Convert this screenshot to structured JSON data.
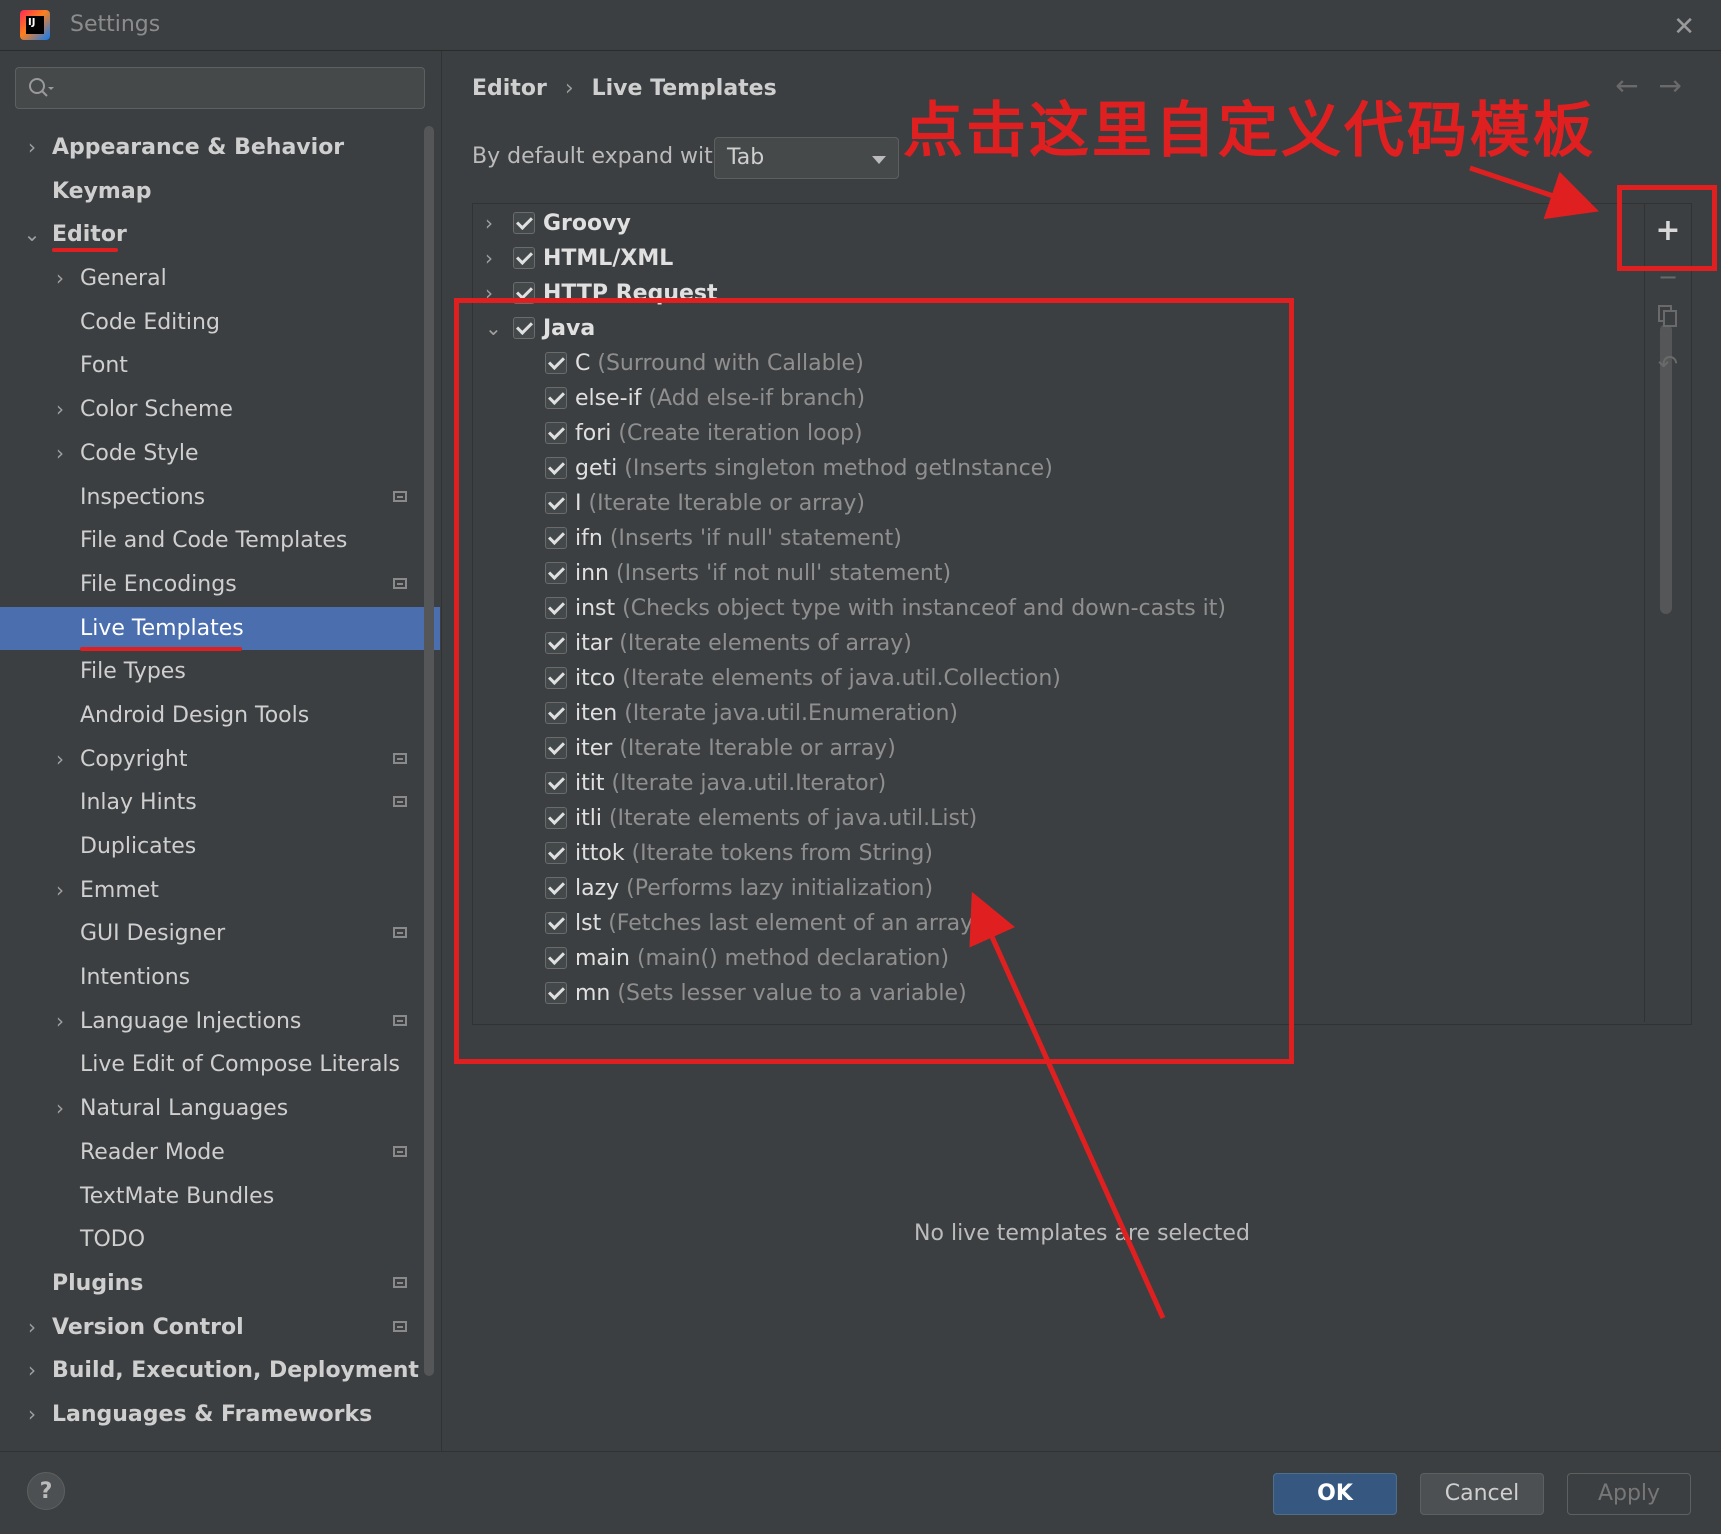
{
  "window": {
    "title": "Settings"
  },
  "sidebar": {
    "items": [
      {
        "label": "Appearance & Behavior",
        "level": 0,
        "arrow": "right",
        "bold": true
      },
      {
        "label": "Keymap",
        "level": 0,
        "arrow": "",
        "bold": true
      },
      {
        "label": "Editor",
        "level": 0,
        "arrow": "down",
        "bold": true
      },
      {
        "label": "General",
        "level": 1,
        "arrow": "right"
      },
      {
        "label": "Code Editing",
        "level": 1,
        "arrow": ""
      },
      {
        "label": "Font",
        "level": 1,
        "arrow": ""
      },
      {
        "label": "Color Scheme",
        "level": 1,
        "arrow": "right"
      },
      {
        "label": "Code Style",
        "level": 1,
        "arrow": "right"
      },
      {
        "label": "Inspections",
        "level": 1,
        "arrow": "",
        "project": true
      },
      {
        "label": "File and Code Templates",
        "level": 1,
        "arrow": ""
      },
      {
        "label": "File Encodings",
        "level": 1,
        "arrow": "",
        "project": true
      },
      {
        "label": "Live Templates",
        "level": 1,
        "arrow": "",
        "selected": true
      },
      {
        "label": "File Types",
        "level": 1,
        "arrow": ""
      },
      {
        "label": "Android Design Tools",
        "level": 1,
        "arrow": ""
      },
      {
        "label": "Copyright",
        "level": 1,
        "arrow": "right",
        "project": true
      },
      {
        "label": "Inlay Hints",
        "level": 1,
        "arrow": "",
        "project": true
      },
      {
        "label": "Duplicates",
        "level": 1,
        "arrow": ""
      },
      {
        "label": "Emmet",
        "level": 1,
        "arrow": "right"
      },
      {
        "label": "GUI Designer",
        "level": 1,
        "arrow": "",
        "project": true
      },
      {
        "label": "Intentions",
        "level": 1,
        "arrow": ""
      },
      {
        "label": "Language Injections",
        "level": 1,
        "arrow": "right",
        "project": true
      },
      {
        "label": "Live Edit of Compose Literals",
        "level": 1,
        "arrow": ""
      },
      {
        "label": "Natural Languages",
        "level": 1,
        "arrow": "right"
      },
      {
        "label": "Reader Mode",
        "level": 1,
        "arrow": "",
        "project": true
      },
      {
        "label": "TextMate Bundles",
        "level": 1,
        "arrow": ""
      },
      {
        "label": "TODO",
        "level": 1,
        "arrow": ""
      },
      {
        "label": "Plugins",
        "level": 0,
        "arrow": "",
        "bold": true,
        "project": true
      },
      {
        "label": "Version Control",
        "level": 0,
        "arrow": "right",
        "bold": true,
        "project": true
      },
      {
        "label": "Build, Execution, Deployment",
        "level": 0,
        "arrow": "right",
        "bold": true
      },
      {
        "label": "Languages & Frameworks",
        "level": 0,
        "arrow": "right",
        "bold": true
      }
    ]
  },
  "breadcrumb": {
    "parent": "Editor",
    "separator": "›",
    "current": "Live Templates"
  },
  "expand": {
    "label": "By default expand with",
    "value": "Tab"
  },
  "groups": [
    {
      "name": "Groovy",
      "expanded": false,
      "checked": true
    },
    {
      "name": "HTML/XML",
      "expanded": false,
      "checked": true
    },
    {
      "name": "HTTP Request",
      "expanded": false,
      "checked": true
    },
    {
      "name": "Java",
      "expanded": true,
      "checked": true
    }
  ],
  "java_templates": [
    {
      "abbr": "C",
      "desc": "(Surround with Callable)"
    },
    {
      "abbr": "else-if",
      "desc": "(Add else-if branch)"
    },
    {
      "abbr": "fori",
      "desc": "(Create iteration loop)"
    },
    {
      "abbr": "geti",
      "desc": "(Inserts singleton method getInstance)"
    },
    {
      "abbr": "I",
      "desc": "(Iterate Iterable or array)"
    },
    {
      "abbr": "ifn",
      "desc": "(Inserts 'if null' statement)"
    },
    {
      "abbr": "inn",
      "desc": "(Inserts 'if not null' statement)"
    },
    {
      "abbr": "inst",
      "desc": "(Checks object type with instanceof and down-casts it)"
    },
    {
      "abbr": "itar",
      "desc": "(Iterate elements of array)"
    },
    {
      "abbr": "itco",
      "desc": "(Iterate elements of java.util.Collection)"
    },
    {
      "abbr": "iten",
      "desc": "(Iterate java.util.Enumeration)"
    },
    {
      "abbr": "iter",
      "desc": "(Iterate Iterable or array)"
    },
    {
      "abbr": "itit",
      "desc": "(Iterate java.util.Iterator)"
    },
    {
      "abbr": "itli",
      "desc": "(Iterate elements of java.util.List)"
    },
    {
      "abbr": "ittok",
      "desc": "(Iterate tokens from String)"
    },
    {
      "abbr": "lazy",
      "desc": "(Performs lazy initialization)"
    },
    {
      "abbr": "lst",
      "desc": "(Fetches last element of an array)"
    },
    {
      "abbr": "main",
      "desc": "(main() method declaration)"
    },
    {
      "abbr": "mn",
      "desc": "(Sets lesser value to a variable)"
    }
  ],
  "toolbar": {
    "add_icon": "plus-icon",
    "copy_icon": "copy-icon",
    "restore_icon": "undo-icon"
  },
  "empty_message": "No live templates are selected",
  "buttons": {
    "ok": "OK",
    "cancel": "Cancel",
    "apply": "Apply",
    "help": "?"
  },
  "annotation": {
    "text": "点击这里自定义代码模板",
    "color": "#e02020"
  },
  "colors": {
    "selection": "#4b6eaf",
    "background": "#3c3f41",
    "ok_button": "#365880"
  }
}
